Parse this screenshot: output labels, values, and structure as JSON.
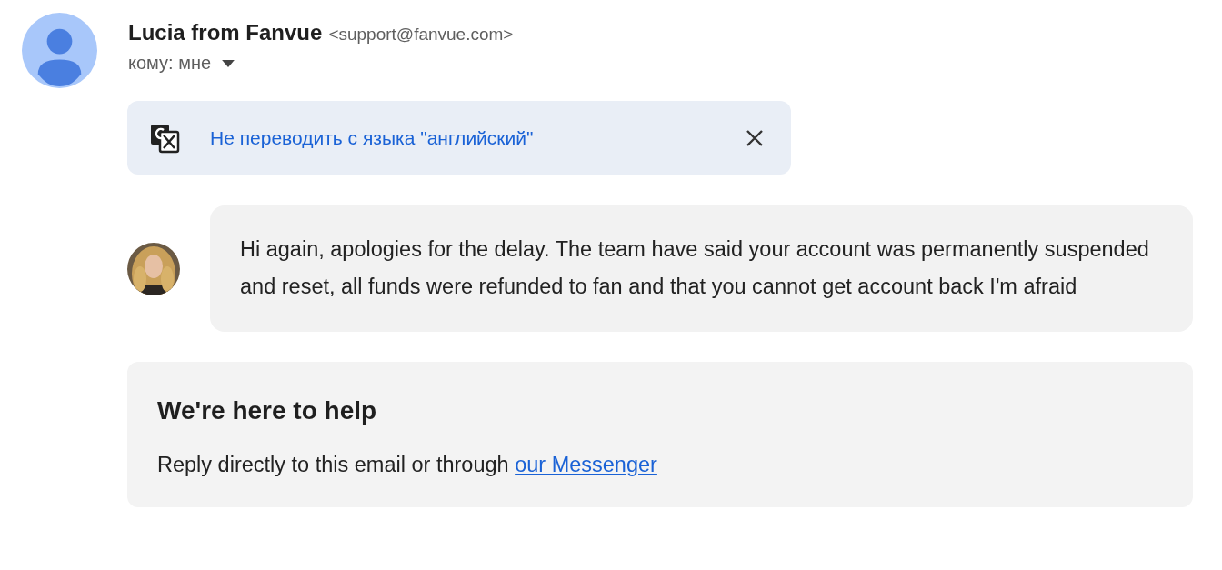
{
  "sender": {
    "name": "Lucia from Fanvue",
    "address": "<support@fanvue.com>",
    "recipient": "кому: мне"
  },
  "translate_bar": {
    "label": "Не переводить с языка \"английский\""
  },
  "message": {
    "text": "Hi again, apologies for the delay. The team have said your account was permanently suspended and reset, all funds were refunded to fan and that you cannot get account back I'm afraid"
  },
  "help_card": {
    "title": "We're here to help",
    "text": "Reply directly to this email or through ",
    "link": "our Messenger"
  }
}
